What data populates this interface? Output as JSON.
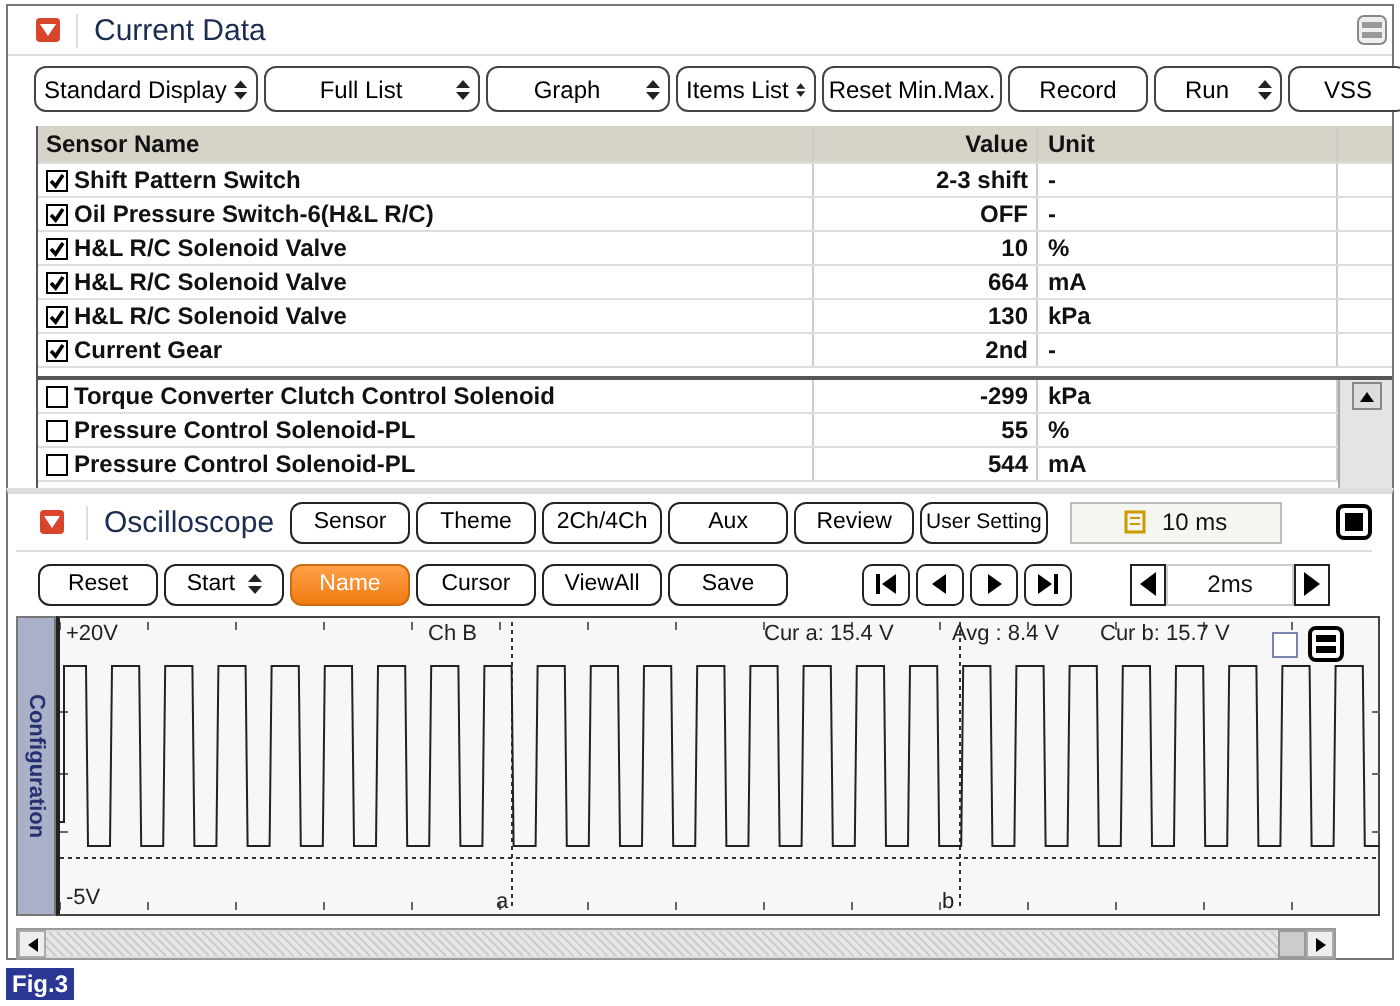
{
  "data_panel": {
    "title": "Current Data",
    "toolbar": [
      {
        "label": "Standard Display",
        "kind": "dropdown"
      },
      {
        "label": "Full List",
        "kind": "dropdown"
      },
      {
        "label": "Graph",
        "kind": "dropdown"
      },
      {
        "label": "Items List",
        "kind": "dropdown"
      },
      {
        "label": "Reset Min.Max.",
        "kind": "button"
      },
      {
        "label": "Record",
        "kind": "button"
      },
      {
        "label": "Run",
        "kind": "dropdown"
      },
      {
        "label": "VSS",
        "kind": "button"
      }
    ],
    "table": {
      "columns": [
        "Sensor Name",
        "Value",
        "Unit"
      ],
      "rows": [
        {
          "name": "Shift Pattern Switch",
          "value": "2-3 shift",
          "unit": "-",
          "checked": true
        },
        {
          "name": "Oil Pressure Switch-6(H&L R/C)",
          "value": "OFF",
          "unit": "-",
          "checked": true
        },
        {
          "name": "H&L R/C Solenoid Valve",
          "value": "10",
          "unit": "%",
          "checked": true
        },
        {
          "name": "H&L R/C Solenoid Valve",
          "value": "664",
          "unit": "mA",
          "checked": true
        },
        {
          "name": "H&L R/C Solenoid Valve",
          "value": "130",
          "unit": "kPa",
          "checked": true
        },
        {
          "name": "Current Gear",
          "value": "2nd",
          "unit": "-",
          "checked": true
        }
      ],
      "other_rows": [
        {
          "name": "Torque Converter Clutch Control Solenoid",
          "value": "-299",
          "unit": "kPa",
          "checked": false
        },
        {
          "name": "Pressure Control Solenoid-PL",
          "value": "55",
          "unit": "%",
          "checked": false
        },
        {
          "name": "Pressure Control Solenoid-PL",
          "value": "544",
          "unit": "mA",
          "checked": false
        }
      ]
    }
  },
  "oscilloscope": {
    "title": "Oscilloscope",
    "top_buttons": [
      "Sensor",
      "Theme",
      "2Ch/4Ch",
      "Aux",
      "Review",
      "User Setting"
    ],
    "time_field": "10 ms",
    "controls": [
      {
        "label": "Reset",
        "kind": "button",
        "selected": false
      },
      {
        "label": "Start",
        "kind": "dropdown",
        "selected": false
      },
      {
        "label": "Name",
        "kind": "button",
        "selected": true
      },
      {
        "label": "Cursor",
        "kind": "button",
        "selected": false
      },
      {
        "label": "ViewAll",
        "kind": "button",
        "selected": false
      },
      {
        "label": "Save",
        "kind": "button",
        "selected": false
      }
    ],
    "timebase": "2ms",
    "side_tab": "Configuration",
    "graph": {
      "top_label": "+20V",
      "bottom_label": "-5V",
      "channel": "Ch B",
      "cursor_a": "Cur a: 15.4 V",
      "average": "Avg : 8.4 V",
      "cursor_b": "Cur b: 15.7 V",
      "marker_a": "a",
      "marker_b": "b",
      "checkbox_checked": false
    }
  },
  "figure_label": "Fig.3"
}
